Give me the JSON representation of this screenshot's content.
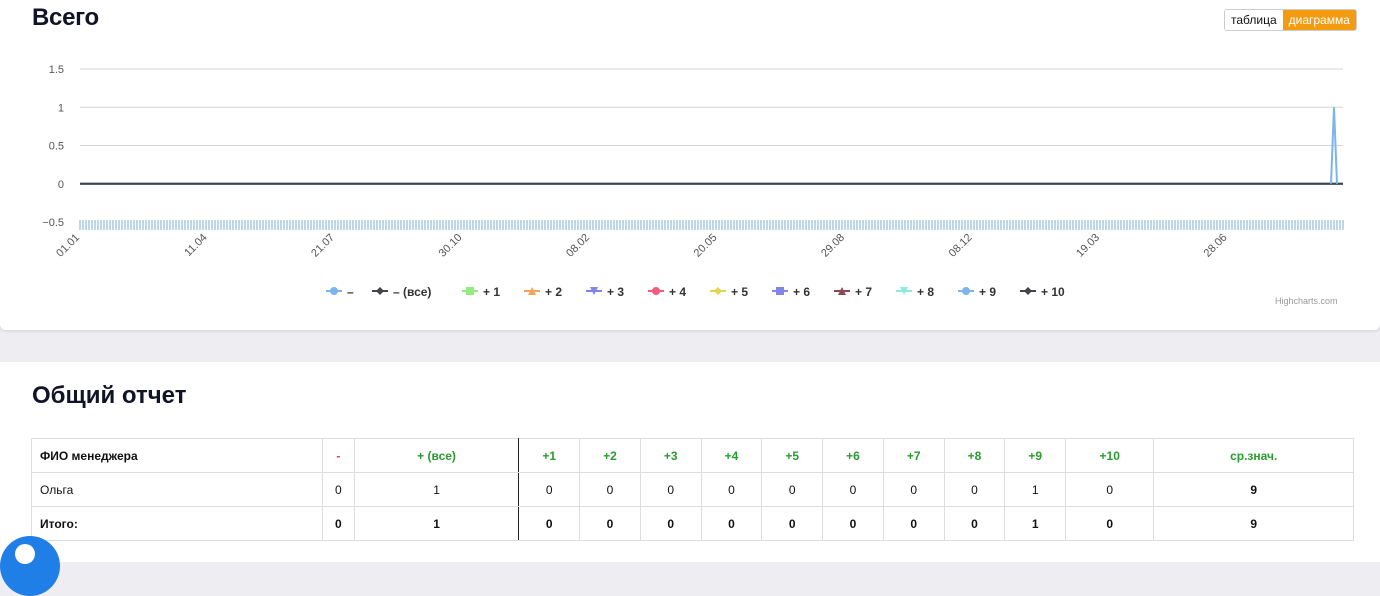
{
  "header": {
    "title": "Всего"
  },
  "view_toggle": {
    "table_label": "таблица",
    "chart_label": "диаграмма",
    "active": "chart"
  },
  "chart_data": {
    "type": "line",
    "y_ticks": [
      "1.5",
      "1",
      "0.5",
      "0",
      "−0.5"
    ],
    "x_ticks": [
      "01.01",
      "11.04",
      "21.07",
      "30.10",
      "08.02",
      "20.05",
      "29.08",
      "08.12",
      "19.03",
      "28.06"
    ],
    "ylim": [
      -0.5,
      1.5
    ],
    "grid": true,
    "legend_position": "bottom",
    "series": [
      {
        "name": "–",
        "color": "#7cb5ec",
        "marker": "circle",
        "values_note": "all 0 except final point = 1"
      },
      {
        "name": "– (все)",
        "color": "#434348",
        "marker": "diamond"
      },
      {
        "name": "+ 1",
        "color": "#90ed7d",
        "marker": "square"
      },
      {
        "name": "+ 2",
        "color": "#f7a35c",
        "marker": "triangle"
      },
      {
        "name": "+ 3",
        "color": "#8085e9",
        "marker": "triangle-down"
      },
      {
        "name": "+ 4",
        "color": "#f15c80",
        "marker": "circle"
      },
      {
        "name": "+ 5",
        "color": "#e4d354",
        "marker": "diamond"
      },
      {
        "name": "+ 6",
        "color": "#8085e8",
        "marker": "square"
      },
      {
        "name": "+ 7",
        "color": "#8d4653",
        "marker": "triangle"
      },
      {
        "name": "+ 8",
        "color": "#91e8e1",
        "marker": "triangle-down"
      },
      {
        "name": "+ 9",
        "color": "#7cb5ec",
        "marker": "circle"
      },
      {
        "name": "+ 10",
        "color": "#434348",
        "marker": "diamond"
      }
    ],
    "spike": {
      "series": "–",
      "value": 1
    },
    "credits": "Highcharts.com"
  },
  "report": {
    "title": "Общий отчет",
    "columns": [
      "ФИО менеджера",
      "-",
      "+ (все)",
      "+1",
      "+2",
      "+3",
      "+4",
      "+5",
      "+6",
      "+7",
      "+8",
      "+9",
      "+10",
      "ср.знач."
    ],
    "rows": [
      [
        "Ольга",
        "0",
        "1",
        "0",
        "0",
        "0",
        "0",
        "0",
        "0",
        "0",
        "0",
        "1",
        "0",
        "9"
      ],
      [
        "Итого:",
        "0",
        "1",
        "0",
        "0",
        "0",
        "0",
        "0",
        "0",
        "0",
        "0",
        "1",
        "0",
        "9"
      ]
    ]
  },
  "colors": {
    "accent": "#f39c12",
    "positive": "#2b9a2f",
    "negative": "#e53935",
    "chat": "#1f7fe6"
  }
}
